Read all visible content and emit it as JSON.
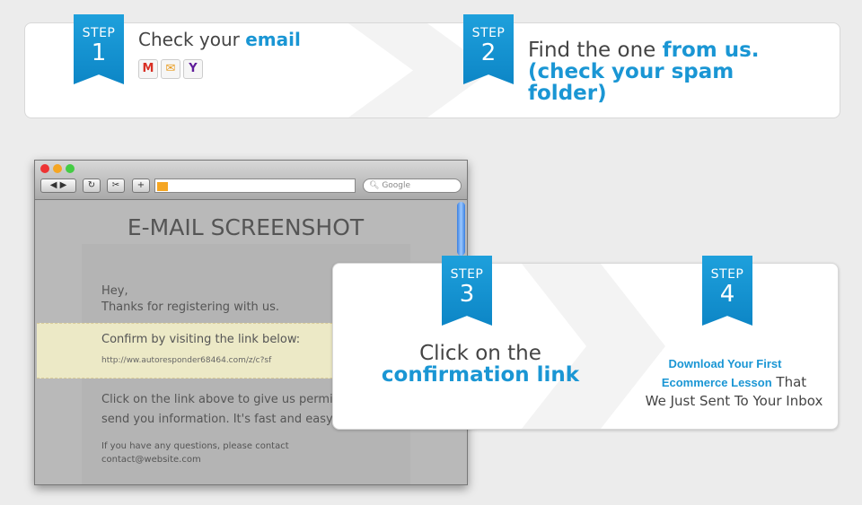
{
  "step1": {
    "step": "STEP",
    "num": "1",
    "text": "Check your ",
    "highlight": "email",
    "providers": [
      {
        "name": "gmail-icon",
        "glyph": "M",
        "color": "#d93025"
      },
      {
        "name": "mail-icon",
        "glyph": "✉",
        "color": "#e89a1c"
      },
      {
        "name": "yahoo-icon",
        "glyph": "Y",
        "color": "#5f1c9a"
      }
    ]
  },
  "step2": {
    "step": "STEP",
    "num": "2",
    "text": "Find the one ",
    "highlight": "from us. (check your spam folder)"
  },
  "browser": {
    "search_placeholder": "Google",
    "title": "E-MAIL SCREENSHOT",
    "greeting": "Hey,",
    "thanks": "Thanks for registering with us.",
    "confirm": "Confirm by visiting the link below:",
    "link": "http://ww.autoresponder68464.com/z/c?sf",
    "body1": "Click on the link above to give us permissi",
    "body2": "send you information. It's fast and easy!",
    "footer1": "If you have any questions, please contact",
    "footer2": "contact@website.com"
  },
  "step3": {
    "step": "STEP",
    "num": "3",
    "text": "Click on the",
    "highlight": "confirmation link"
  },
  "step4": {
    "step": "STEP",
    "num": "4",
    "highlight1": "Download Your First",
    "highlight2": "Ecommerce Lesson",
    "text1": " That",
    "text2": "We Just Sent To Your Inbox"
  },
  "colors": {
    "accent": "#1a96d4"
  }
}
